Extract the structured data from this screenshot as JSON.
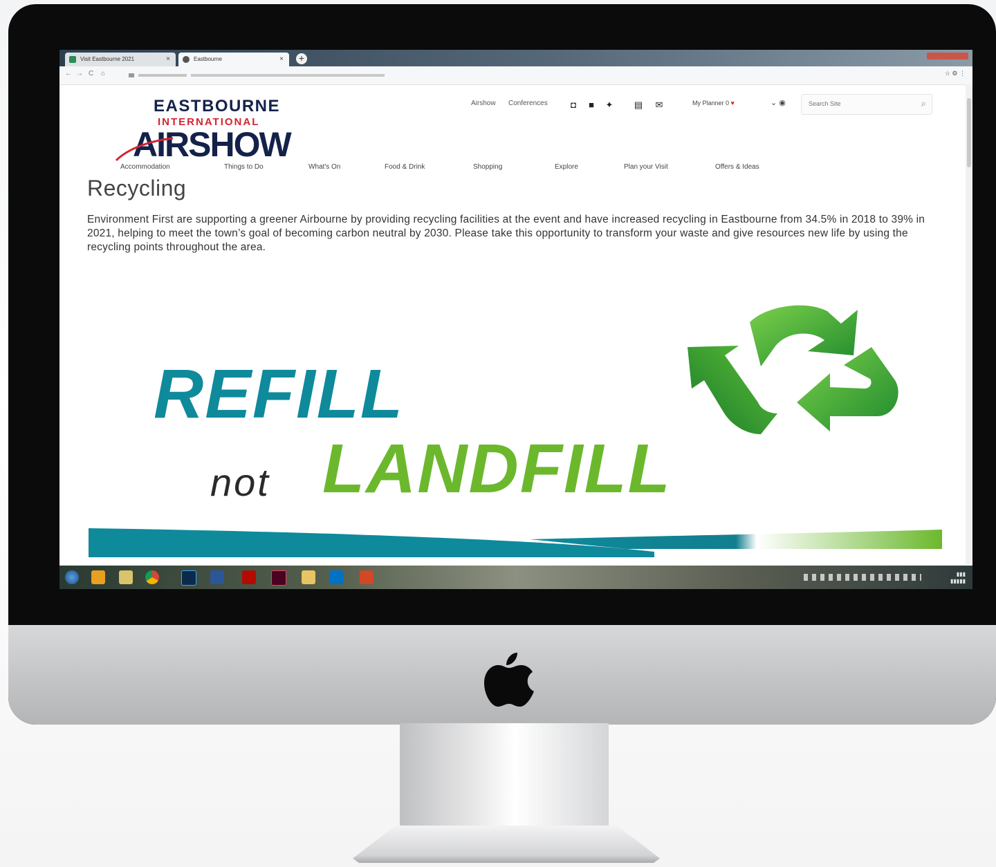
{
  "browser": {
    "tabs": [
      {
        "label": "Visit Eastbourne 2021",
        "favicon_color": "#2e8b57"
      },
      {
        "label": "Eastbourne",
        "favicon_color": "#555555"
      }
    ],
    "new_tab_label": "+",
    "nav": {
      "back": "←",
      "forward": "→",
      "reload": "C",
      "home": "⌂"
    }
  },
  "site": {
    "logo": {
      "top": "EASTBOURNE",
      "middle": "INTERNATIONAL",
      "main": "AIRSHOW"
    },
    "top_links": [
      "Airshow",
      "Conferences"
    ],
    "social_icons": [
      "instagram-icon",
      "facebook-icon",
      "twitter-icon",
      "brochure-icon",
      "mail-icon"
    ],
    "planner_label": "My Planner 0",
    "search": {
      "placeholder": "Search Site"
    },
    "main_nav": [
      "Accommodation",
      "Things to Do",
      "What's On",
      "Food & Drink",
      "Shopping",
      "Explore",
      "Plan your Visit",
      "Offers & Ideas"
    ]
  },
  "page": {
    "title": "Recycling",
    "intro": "Environment First are supporting a greener Airbourne by providing recycling facilities at the event and have increased recycling in Eastbourne from 34.5% in 2018 to 39% in 2021, helping to meet the town’s goal of becoming carbon neutral by 2030. Please take this opportunity to transform your waste and give resources new life by using the recycling points throughout the area."
  },
  "banner": {
    "line1": "REFILL",
    "line2_small": "not",
    "line2_big": "LANDFILL",
    "colors": {
      "refill": "#0e8a9b",
      "landfill": "#6bb82d",
      "not": "#2a2a2a"
    }
  },
  "taskbar": {
    "icons": [
      "start-orb",
      "explorer",
      "outlook-folder",
      "chrome",
      "photoshop",
      "word",
      "acrobat",
      "indesign",
      "folder",
      "outlook",
      "powerpoint"
    ]
  }
}
